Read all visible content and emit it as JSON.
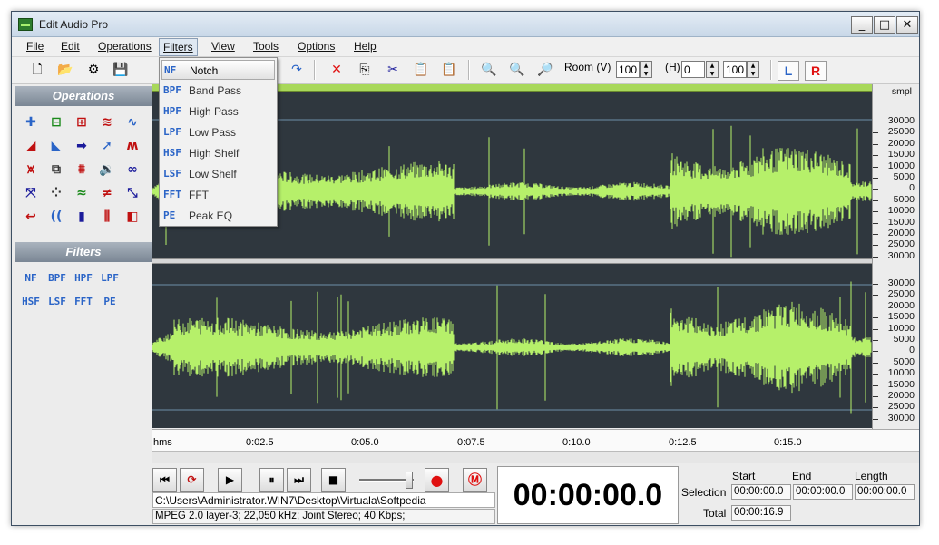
{
  "window": {
    "title": "Edit Audio Pro",
    "buttons": {
      "minimize": "_",
      "maximize": "□",
      "close": "✕"
    }
  },
  "menubar": [
    "File",
    "Edit",
    "Operations",
    "Filters",
    "View",
    "Tools",
    "Options",
    "Help"
  ],
  "toolbar": {
    "room_label": "Room (V)",
    "room_value": "100",
    "h_label": "(H)",
    "h_value": "0",
    "h2_value": "100",
    "left_channel": "L",
    "right_channel": "R"
  },
  "panels": {
    "operations_title": "Operations",
    "filters_title": "Filters",
    "filter_icons": [
      "NF",
      "BPF",
      "HPF",
      "LPF",
      "HSF",
      "LSF",
      "FFT",
      "PE"
    ]
  },
  "filters_menu": [
    {
      "abbr": "NF",
      "label": "Notch"
    },
    {
      "abbr": "BPF",
      "label": "Band Pass"
    },
    {
      "abbr": "HPF",
      "label": "High Pass"
    },
    {
      "abbr": "LPF",
      "label": "Low Pass"
    },
    {
      "abbr": "HSF",
      "label": "High Shelf"
    },
    {
      "abbr": "LSF",
      "label": "Low Shelf"
    },
    {
      "abbr": "FFT",
      "label": "FFT"
    },
    {
      "abbr": "PE",
      "label": "Peak EQ"
    }
  ],
  "scale": {
    "unit": "smpl",
    "top_channel": [
      "30000",
      "25000",
      "20000",
      "15000",
      "10000",
      "5000",
      "0",
      "5000",
      "10000",
      "15000",
      "20000",
      "25000",
      "30000"
    ],
    "bottom_channel": [
      "30000",
      "25000",
      "20000",
      "15000",
      "10000",
      "5000",
      "0",
      "5000",
      "10000",
      "15000",
      "20000",
      "25000",
      "30000"
    ]
  },
  "timeline": {
    "unit": "hms",
    "labels": [
      "0:02.5",
      "0:05.0",
      "0:07.5",
      "0:10.0",
      "0:12.5",
      "0:15.0"
    ]
  },
  "status": {
    "file_path": "C:\\Users\\Administrator.WIN7\\Desktop\\Virtuala\\Softpedia",
    "format_info": "MPEG 2.0 layer-3; 22,050 kHz; Joint Stereo; 40 Kbps;",
    "current_time": "00:00:00.0"
  },
  "selection": {
    "start_header": "Start",
    "end_header": "End",
    "length_header": "Length",
    "selection_label": "Selection",
    "total_label": "Total",
    "start": "00:00:00.0",
    "end": "00:00:00.0",
    "length": "00:00:00.0",
    "total": "00:00:16.9"
  },
  "colors": {
    "waveform": "#b6f06a",
    "wave_background": "#2f373e",
    "record": "#e01010",
    "filter_icon": "#2a64c7"
  }
}
